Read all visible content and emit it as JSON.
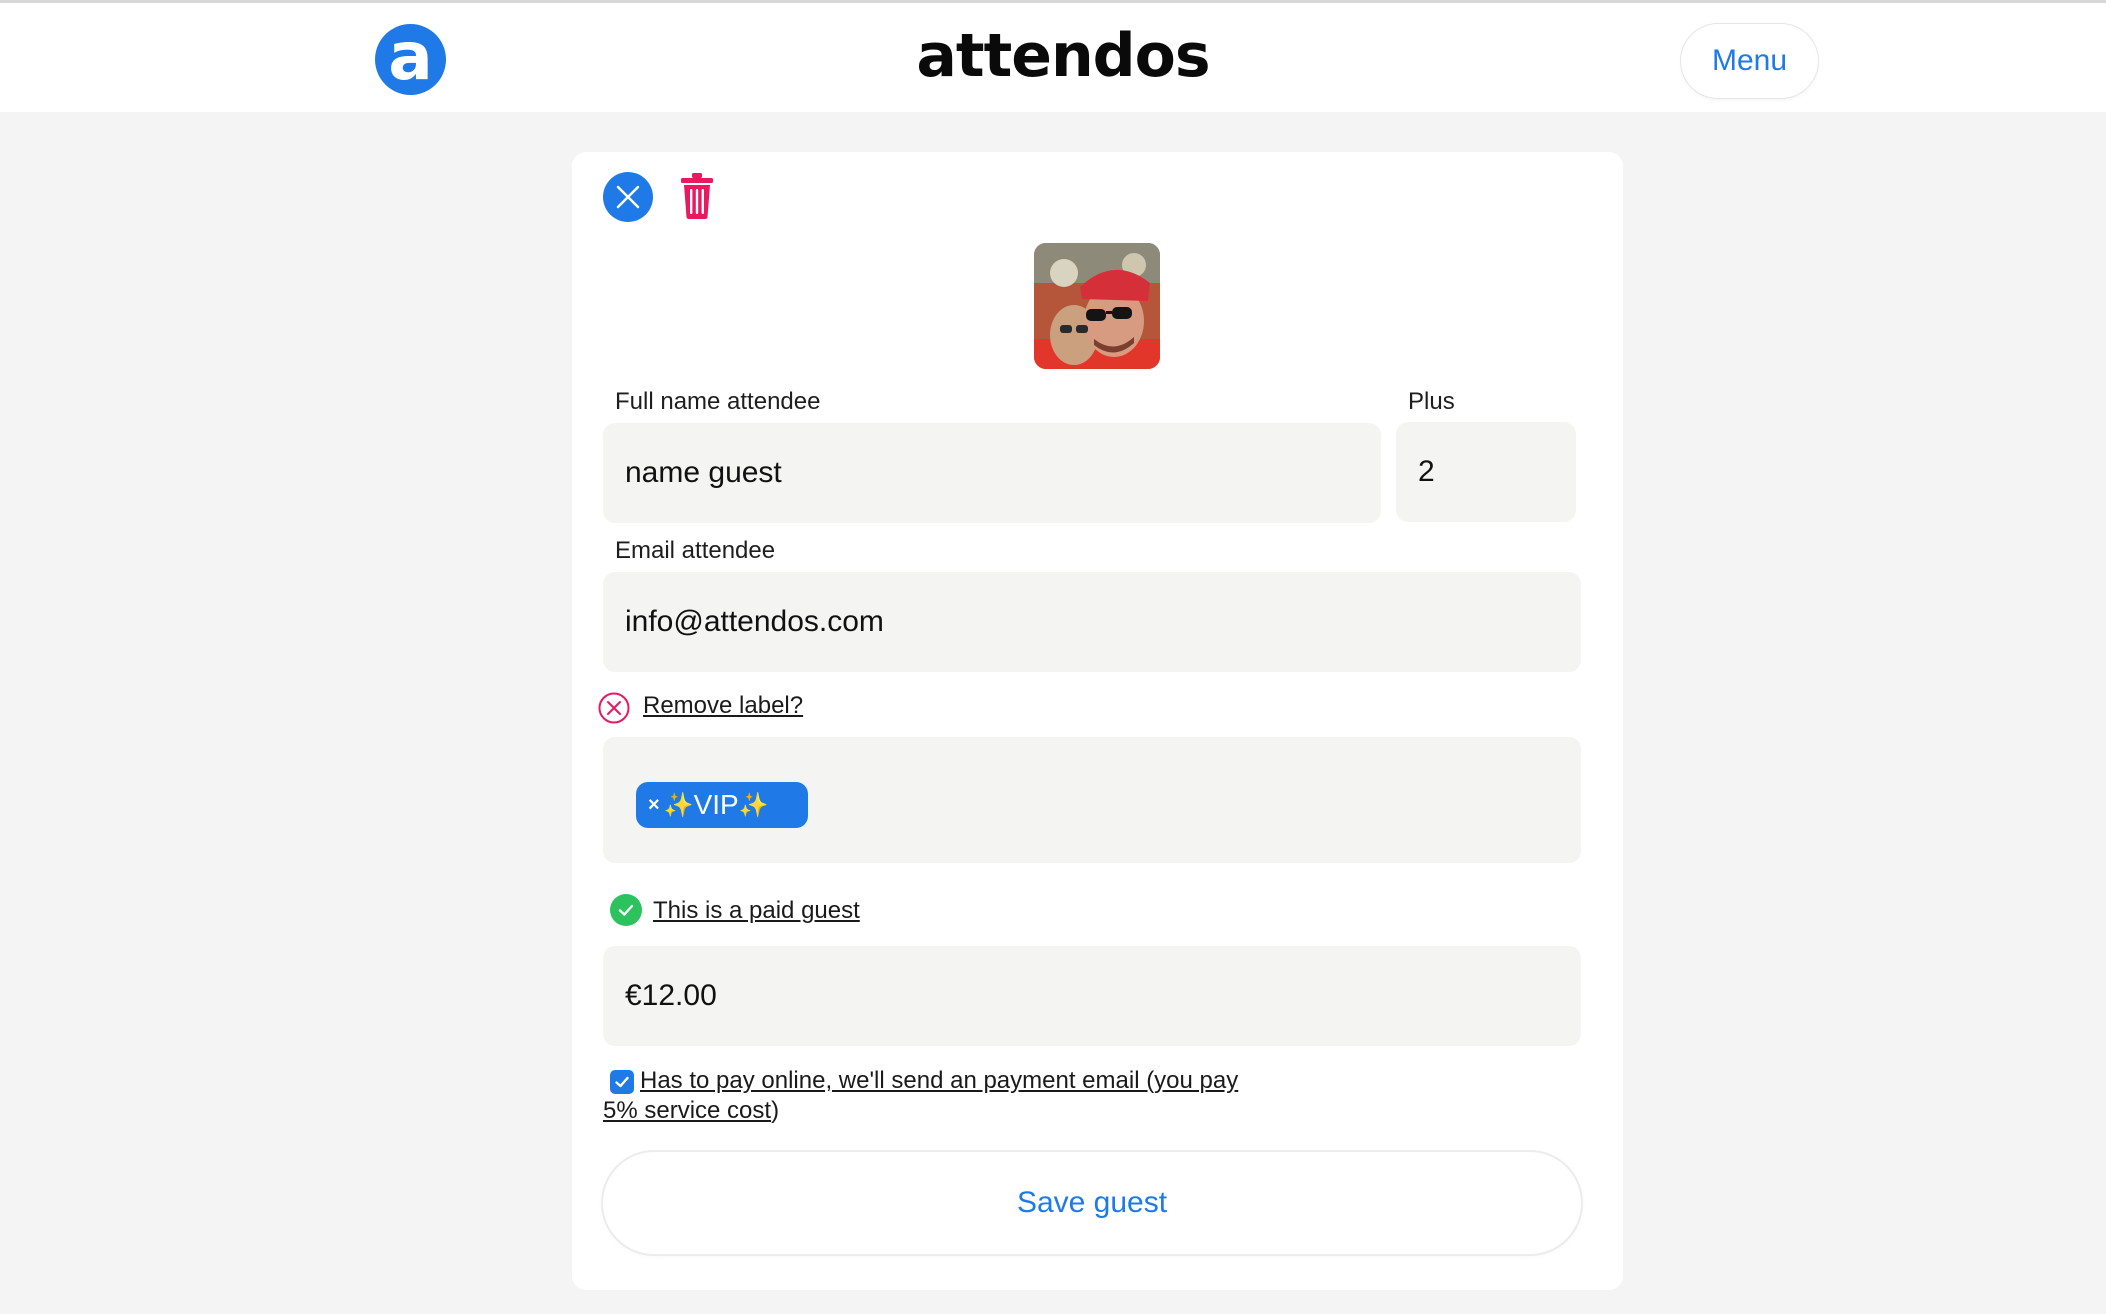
{
  "header": {
    "logo_letter": "a",
    "brand": "attendos",
    "menu_label": "Menu"
  },
  "form": {
    "full_name_label": "Full name attendee",
    "full_name_value": "name guest",
    "plus_label": "Plus",
    "plus_value": "2",
    "email_label": "Email attendee",
    "email_value": "info@attendos.com",
    "remove_label_link": "Remove label?",
    "label_chip": {
      "remove_glyph": "×",
      "sparkle": "✨",
      "text": " VIP"
    },
    "paid_guest_link": "This is a paid guest",
    "price_value": "€12.00",
    "pay_online_text": "Has to pay online, we'll send an payment email (you pay 5% service cost",
    "pay_online_suffix": ")",
    "pay_online_checked": true,
    "save_label": "Save guest"
  },
  "colors": {
    "accent": "#1f7ae8",
    "danger": "#e8195f",
    "success": "#2cc35e",
    "field_bg": "#f4f4f3",
    "page_bg": "#f4f4f4"
  },
  "icons": {
    "close": "close-icon",
    "delete": "trash-icon",
    "remove_label": "remove-circle-icon",
    "paid": "check-circle-icon",
    "checkbox": "checkbox-checked-icon"
  }
}
